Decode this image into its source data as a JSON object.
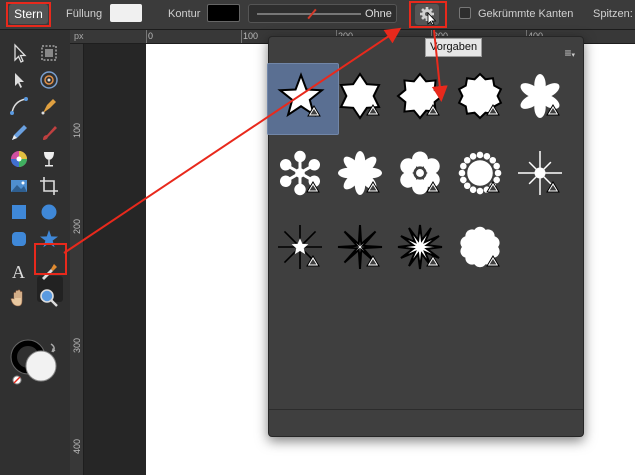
{
  "toolbar": {
    "shape_name": "Stern",
    "fill_label": "Füllung",
    "fill_color": "#f0f0f0",
    "stroke_label": "Kontur",
    "stroke_color": "#000000",
    "stroke_width_value": "Ohne",
    "curved_edges_label": "Gekrümmte Kanten",
    "curved_edges_checked": false,
    "points_label": "Spitzen:"
  },
  "tooltip": {
    "text": "Vorgaben"
  },
  "ruler": {
    "unit": "px",
    "top_ticks": [
      "0",
      "100",
      "200",
      "300",
      "400"
    ],
    "left_ticks": [
      "100",
      "200",
      "300",
      "400"
    ]
  },
  "tools": [
    {
      "name": "move-tool-icon"
    },
    {
      "name": "artboard-tool-icon"
    },
    {
      "name": "node-tool-icon"
    },
    {
      "name": "gradient-tool-icon"
    },
    {
      "name": "corner-tool-icon"
    },
    {
      "name": "pen-tool-icon"
    },
    {
      "name": "pencil-tool-icon"
    },
    {
      "name": "brush-tool-icon"
    },
    {
      "name": "color-wheel-tool-icon"
    },
    {
      "name": "transparency-tool-icon"
    },
    {
      "name": "place-image-tool-icon"
    },
    {
      "name": "crop-tool-icon"
    },
    {
      "name": "rectangle-tool-icon"
    },
    {
      "name": "ellipse-tool-icon"
    },
    {
      "name": "rounded-rectangle-tool-icon"
    },
    {
      "name": "star-tool-icon"
    },
    {
      "name": "text-tool-icon"
    },
    {
      "name": "color-picker-tool-icon"
    },
    {
      "name": "hand-tool-icon"
    },
    {
      "name": "zoom-tool-icon"
    }
  ],
  "presets": [
    {
      "name": "star-5-points",
      "shape": "star",
      "n": 5,
      "inner": 0.42,
      "selected": true
    },
    {
      "name": "star-6-points",
      "shape": "star",
      "n": 6,
      "inner": 0.62
    },
    {
      "name": "star-8-points",
      "shape": "star",
      "n": 8,
      "inner": 0.72
    },
    {
      "name": "star-10-points",
      "shape": "star",
      "n": 10,
      "inner": 0.8
    },
    {
      "name": "asterisk-6-petals",
      "shape": "petals",
      "n": 6,
      "petal": 0.26
    },
    {
      "name": "flower-6-petals",
      "shape": "flower",
      "n": 6
    },
    {
      "name": "asterisk-8-petals",
      "shape": "petals",
      "n": 8,
      "petal": 0.24
    },
    {
      "name": "flower-6-round-petals",
      "shape": "roundflower",
      "n": 6
    },
    {
      "name": "dotted-ring",
      "shape": "dotring",
      "n": 16
    },
    {
      "name": "spoke-burst",
      "shape": "spokes",
      "n": 8
    },
    {
      "name": "spoke-star-5",
      "shape": "spokestar",
      "n": 5
    },
    {
      "name": "thin-star-8",
      "shape": "star",
      "n": 8,
      "inner": 0.14
    },
    {
      "name": "star-12-points",
      "shape": "star",
      "n": 12,
      "inner": 0.32
    },
    {
      "name": "cloud-flower",
      "shape": "cloud",
      "n": 10
    }
  ],
  "colors": {
    "accent_red": "#e8291c",
    "selection_blue": "#5a6f92"
  }
}
